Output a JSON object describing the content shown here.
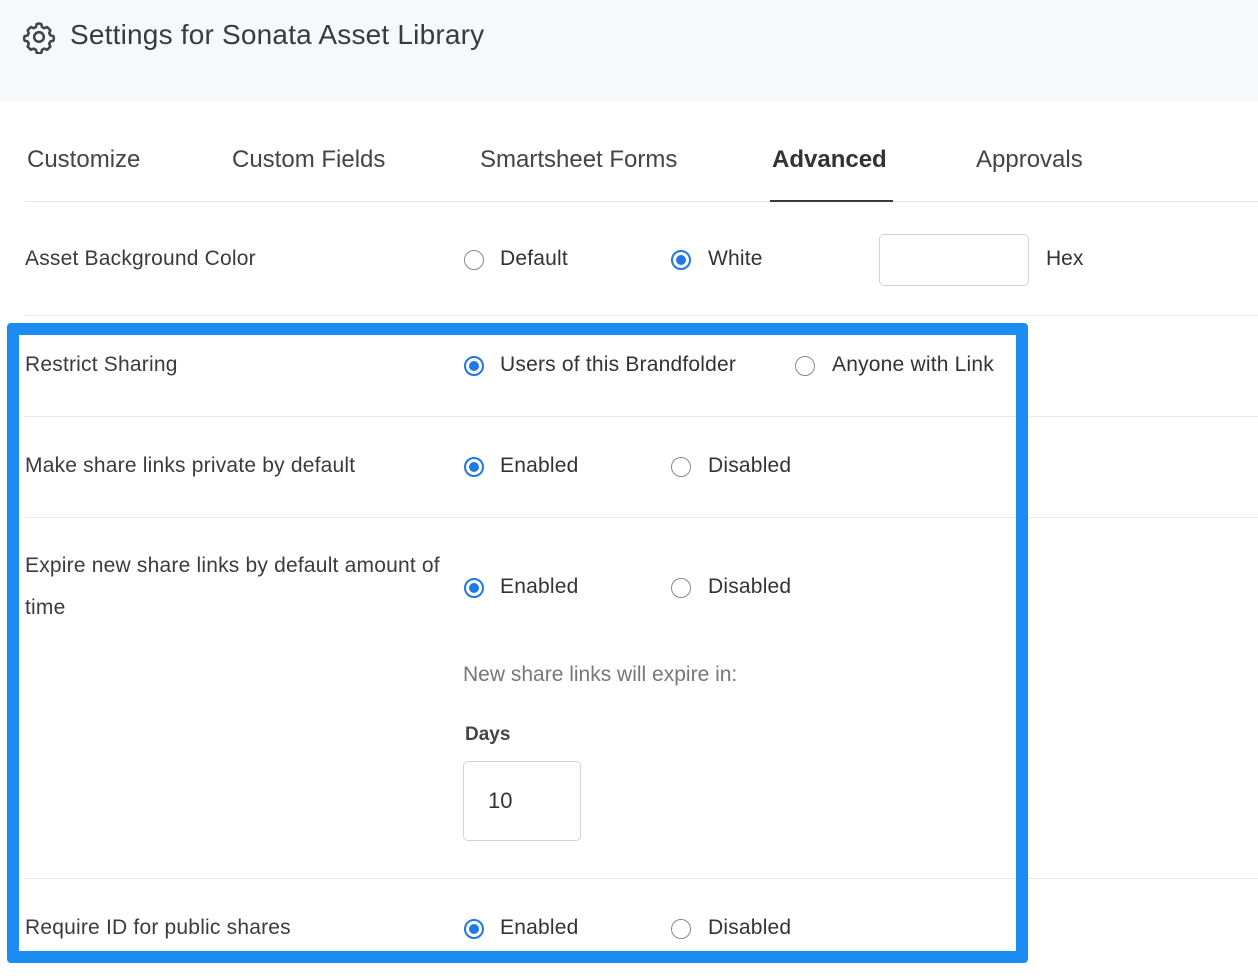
{
  "header": {
    "title": "Settings for Sonata Asset Library",
    "icon": "gear-icon"
  },
  "tabs": [
    {
      "label": "Customize",
      "active": false
    },
    {
      "label": "Custom Fields",
      "active": false
    },
    {
      "label": "Smartsheet Forms",
      "active": false
    },
    {
      "label": "Advanced",
      "active": true
    },
    {
      "label": "Approvals",
      "active": false
    }
  ],
  "settings": {
    "background_color": {
      "label": "Asset Background Color",
      "options": [
        {
          "label": "Default",
          "selected": false
        },
        {
          "label": "White",
          "selected": true
        }
      ],
      "hex_value": "",
      "hex_label": "Hex"
    },
    "restrict_sharing": {
      "label": "Restrict Sharing",
      "options": [
        {
          "label": "Users of this Brandfolder",
          "selected": true
        },
        {
          "label": "Anyone with Link",
          "selected": false
        }
      ]
    },
    "private_links": {
      "label": "Make share links private by default",
      "options": [
        {
          "label": "Enabled",
          "selected": true
        },
        {
          "label": "Disabled",
          "selected": false
        }
      ]
    },
    "expire_links": {
      "label_line1": "Expire new share links by default amount of",
      "label_line2": "time",
      "options": [
        {
          "label": "Enabled",
          "selected": true
        },
        {
          "label": "Disabled",
          "selected": false
        }
      ],
      "note": "New share links will expire in:",
      "days_label": "Days",
      "days_value": "10"
    },
    "require_id": {
      "label": "Require ID for public shares",
      "options": [
        {
          "label": "Enabled",
          "selected": true
        },
        {
          "label": "Disabled",
          "selected": false
        }
      ]
    }
  },
  "colors": {
    "accent": "#1e78e8",
    "highlight": "#1a8cf2",
    "header_bg": "#f7f8f9"
  }
}
